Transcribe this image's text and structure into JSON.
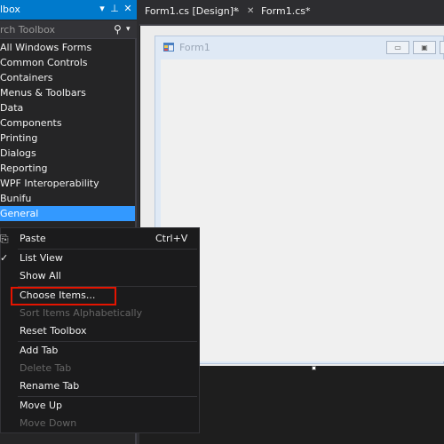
{
  "toolbox": {
    "title": "lbox",
    "search_placeholder": "rch Toolbox",
    "items": [
      {
        "label": "All Windows Forms"
      },
      {
        "label": "Common Controls"
      },
      {
        "label": "Containers"
      },
      {
        "label": "Menus & Toolbars"
      },
      {
        "label": "Data"
      },
      {
        "label": "Components"
      },
      {
        "label": "Printing"
      },
      {
        "label": "Dialogs"
      },
      {
        "label": "Reporting"
      },
      {
        "label": "WPF Interoperability"
      },
      {
        "label": "Bunifu"
      },
      {
        "label": "General"
      }
    ],
    "selected": "General"
  },
  "tabs": [
    {
      "label": "Form1.cs [Design]*"
    },
    {
      "label": "Form1.cs*"
    }
  ],
  "form": {
    "title": "Form1"
  },
  "context_menu": {
    "paste": {
      "label": "Paste",
      "shortcut": "Ctrl+V"
    },
    "list_view": {
      "label": "List View",
      "checked": true
    },
    "show_all": {
      "label": "Show All"
    },
    "choose_items": {
      "label": "Choose Items..."
    },
    "sort_alpha": {
      "label": "Sort Items Alphabetically",
      "disabled": true
    },
    "reset_toolbox": {
      "label": "Reset Toolbox"
    },
    "add_tab": {
      "label": "Add Tab"
    },
    "delete_tab": {
      "label": "Delete Tab",
      "disabled": true
    },
    "rename_tab": {
      "label": "Rename Tab"
    },
    "move_up": {
      "label": "Move Up"
    },
    "move_down": {
      "label": "Move Down",
      "disabled": true
    }
  },
  "colors": {
    "accent": "#007acc",
    "selection": "#3399ff",
    "highlight_box": "#e51400"
  }
}
